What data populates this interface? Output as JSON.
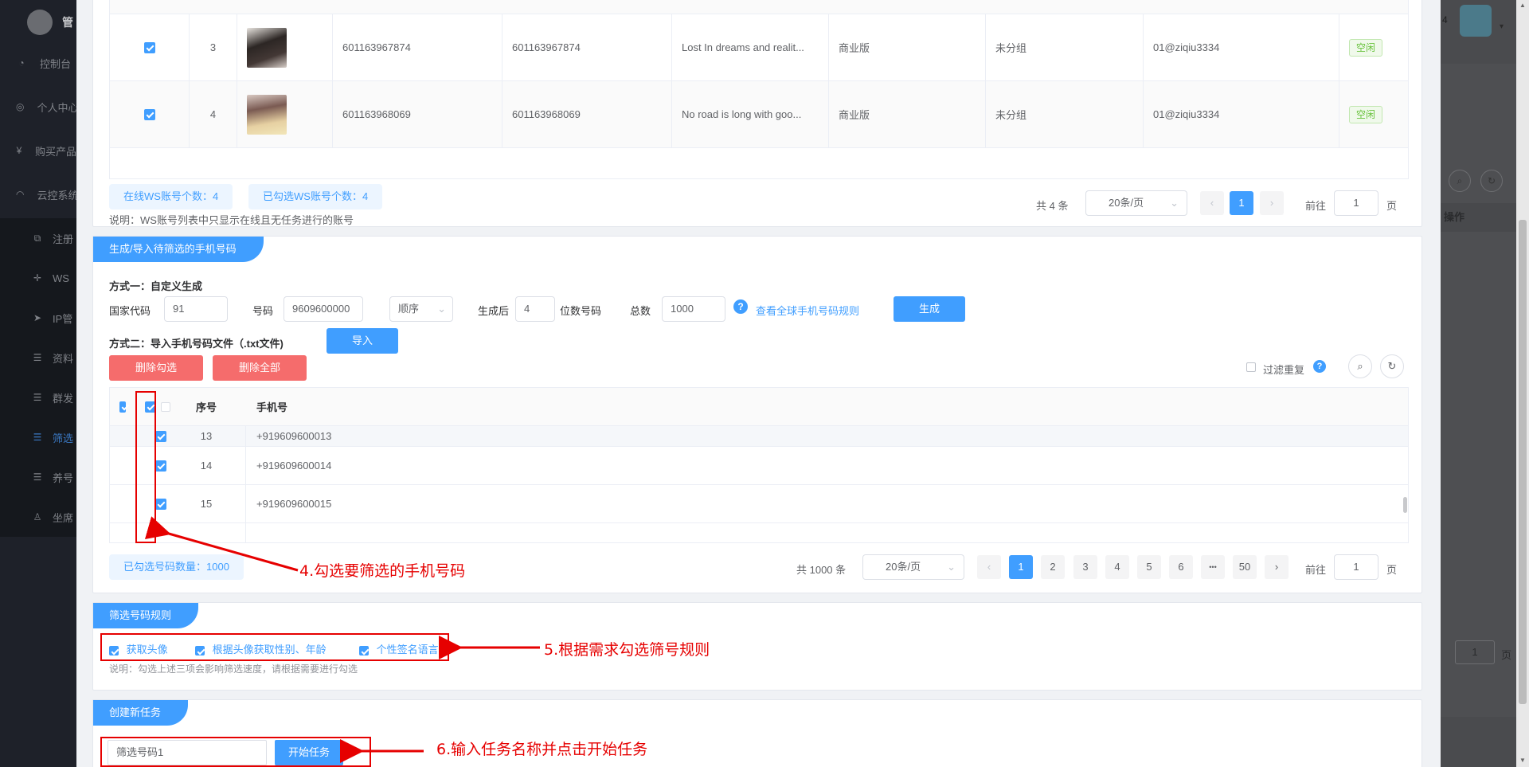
{
  "bg_sidebar": {
    "brand": "管",
    "items": [
      {
        "label": "控制台",
        "icon": "dashboard-icon",
        "glyph": "◔"
      },
      {
        "label": "个人中心",
        "icon": "user-center-icon",
        "glyph": "◎"
      },
      {
        "label": "购买产品",
        "icon": "yen-icon",
        "glyph": "¥"
      },
      {
        "label": "云控系统",
        "icon": "headset-icon",
        "glyph": "◠"
      },
      {
        "label": "注册",
        "icon": "external-link-icon",
        "glyph": "⧉"
      },
      {
        "label": "WS",
        "icon": "move-icon",
        "glyph": "✛"
      },
      {
        "label": "IP管",
        "icon": "send-icon",
        "glyph": "➤"
      },
      {
        "label": "资料",
        "icon": "menu-icon",
        "glyph": "☰"
      },
      {
        "label": "群发",
        "icon": "menu-icon",
        "glyph": "☰"
      },
      {
        "label": "筛选",
        "icon": "menu-icon",
        "glyph": "☰"
      },
      {
        "label": "养号",
        "icon": "menu-icon",
        "glyph": "☰"
      },
      {
        "label": "坐席",
        "icon": "person-icon",
        "glyph": "♙"
      }
    ]
  },
  "bg_right": {
    "header_count": "4",
    "op_header": "操作",
    "pager_value": "1",
    "pager_unit": "页"
  },
  "accounts": {
    "rows": [
      {
        "index": "3",
        "col1": "601163967874",
        "col2": "601163967874",
        "signature": "Lost In dreams and realit...",
        "version": "商业版",
        "group": "未分组",
        "owner": "01@ziqiu3334",
        "status": "空闲",
        "avatar_color": "#3a3230"
      },
      {
        "index": "4",
        "col1": "601163968069",
        "col2": "601163968069",
        "signature": "No road is long with goo...",
        "version": "商业版",
        "group": "未分组",
        "owner": "01@ziqiu3334",
        "status": "空闲",
        "avatar_color": "#b89a8c"
      }
    ],
    "online_tag": "在线WS账号个数：4",
    "selected_tag": "已勾选WS账号个数：4",
    "note": "说明：WS账号列表中只显示在线且无任务进行的账号",
    "pager": {
      "total": "共 4 条",
      "page_size": "20条/页",
      "current": "1",
      "goto_label": "前往",
      "goto_value": "1",
      "goto_unit": "页"
    }
  },
  "generate": {
    "tab": "生成/导入待筛选的手机号码",
    "method1": "方式一：自定义生成",
    "country_code_label": "国家代码",
    "country_code_value": "91",
    "number_label": "号码",
    "number_value": "9609600000",
    "order_value": "顺序",
    "after_label": "生成后",
    "digits_value": "4",
    "digits_label": "位数号码",
    "total_label": "总数",
    "total_value": "1000",
    "rules_link": "查看全球手机号码规则",
    "generate_btn": "生成",
    "method2": "方式二：导入手机号码文件（.txt文件)",
    "import_btn": "导入",
    "delete_selected_btn": "删除勾选",
    "delete_all_btn": "删除全部",
    "filter_dup_label": "过滤重复",
    "table_headers": {
      "index": "序号",
      "phone": "手机号"
    },
    "rows": [
      {
        "index": "13",
        "phone": "+919609600013"
      },
      {
        "index": "14",
        "phone": "+919609600014"
      },
      {
        "index": "15",
        "phone": "+919609600015"
      }
    ],
    "selected_count_tag": "已勾选号码数量：1000",
    "pager": {
      "total": "共 1000 条",
      "page_size": "20条/页",
      "pages": [
        "1",
        "2",
        "3",
        "4",
        "5",
        "6",
        "•••",
        "50"
      ],
      "current": "1",
      "goto_label": "前往",
      "goto_value": "1",
      "goto_unit": "页"
    }
  },
  "rules": {
    "tab": "筛选号码规则",
    "options": [
      "获取头像",
      "根据头像获取性别、年龄",
      "个性签名语言"
    ],
    "note": "说明：勾选上述三项会影响筛选速度，请根据需要进行勾选"
  },
  "task": {
    "tab": "创建新任务",
    "name_value": "筛选号码1",
    "start_btn": "开始任务"
  },
  "annotations": {
    "step4": "4.勾选要筛选的手机号码",
    "step5": "5.根据需求勾选筛号规则",
    "step6": "6.输入任务名称并点击开始任务"
  },
  "colors": {
    "primary": "#409eff",
    "danger": "#f56c6c",
    "success": "#67c23a",
    "annotation": "#e60000"
  }
}
